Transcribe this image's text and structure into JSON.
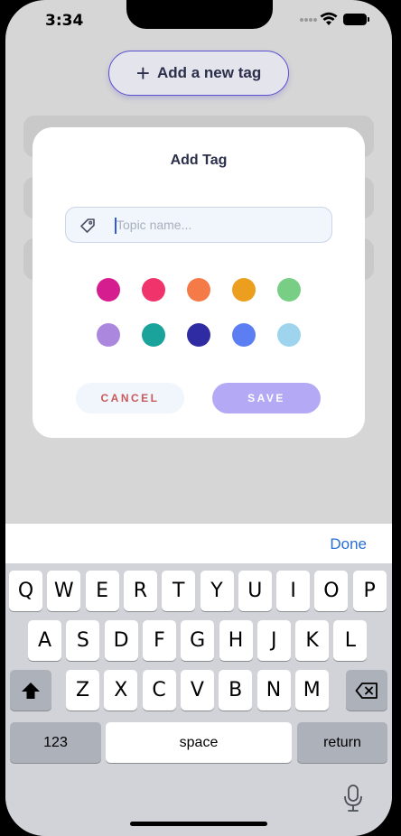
{
  "status_bar": {
    "time": "3:34"
  },
  "background": {
    "add_tag_button_label": "Add a new tag"
  },
  "modal": {
    "title": "Add Tag",
    "topic_input": {
      "placeholder": "Topic name...",
      "value": ""
    },
    "colors": [
      "#d61d8f",
      "#f0346b",
      "#f47a48",
      "#ec9e1e",
      "#79ce86",
      "#ab88de",
      "#1aa39b",
      "#2e2ba3",
      "#5b7ff2",
      "#9ed4ee"
    ],
    "cancel_label": "CANCEL",
    "save_label": "SAVE"
  },
  "keyboard": {
    "done_label": "Done",
    "row1": [
      "Q",
      "W",
      "E",
      "R",
      "T",
      "Y",
      "U",
      "I",
      "O",
      "P"
    ],
    "row2": [
      "A",
      "S",
      "D",
      "F",
      "G",
      "H",
      "J",
      "K",
      "L"
    ],
    "row3": [
      "Z",
      "X",
      "C",
      "V",
      "B",
      "N",
      "M"
    ],
    "numbers_label": "123",
    "space_label": "space",
    "return_label": "return"
  }
}
